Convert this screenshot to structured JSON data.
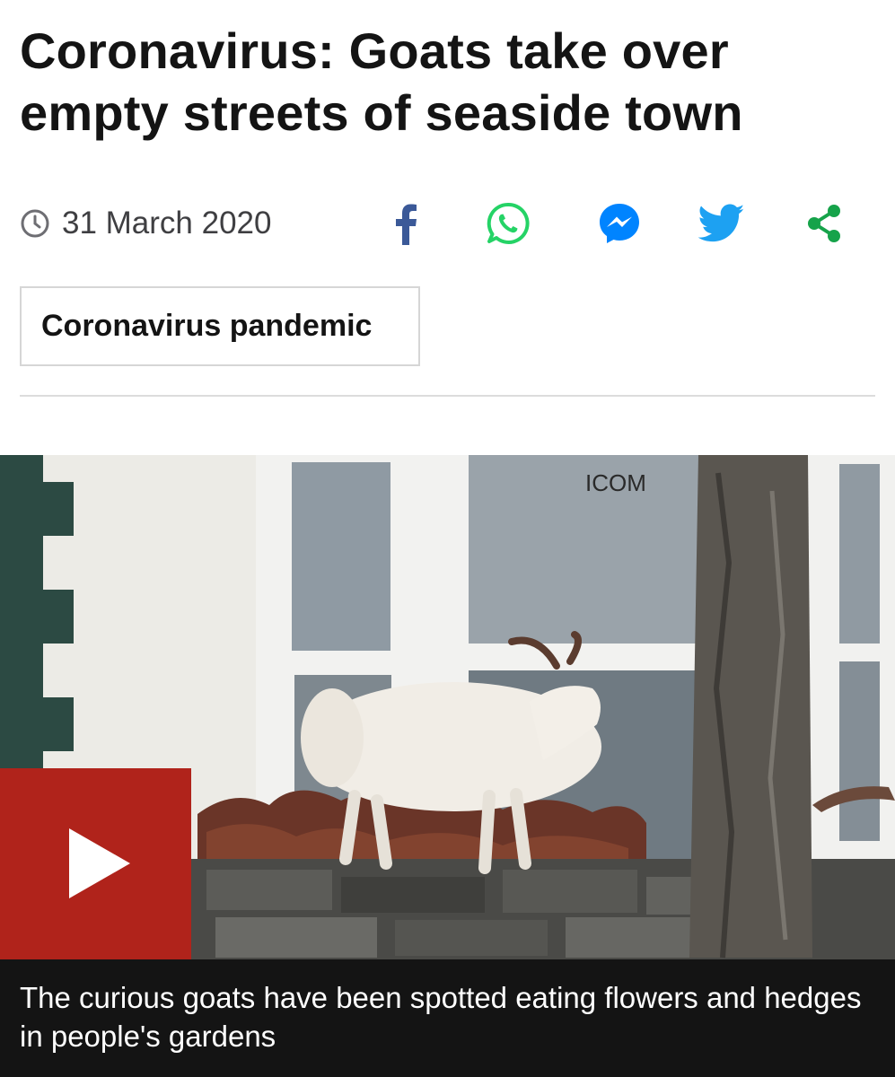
{
  "article": {
    "headline": "Coronavirus: Goats take over empty streets of seaside town",
    "date": "31 March 2020",
    "topic_tag": "Coronavirus pandemic"
  },
  "share": {
    "icons": [
      "facebook-icon",
      "whatsapp-icon",
      "messenger-icon",
      "twitter-icon",
      "share-icon"
    ]
  },
  "media": {
    "sign_text": "ICOM",
    "caption": "The curious goats have been spotted eating flowers and hedges in people's gardens"
  },
  "colors": {
    "play_button": "#b0231b",
    "facebook": "#3b5998",
    "whatsapp": "#25d366",
    "messenger": "#0084ff",
    "twitter": "#1da1f2",
    "share": "#16a34a"
  }
}
